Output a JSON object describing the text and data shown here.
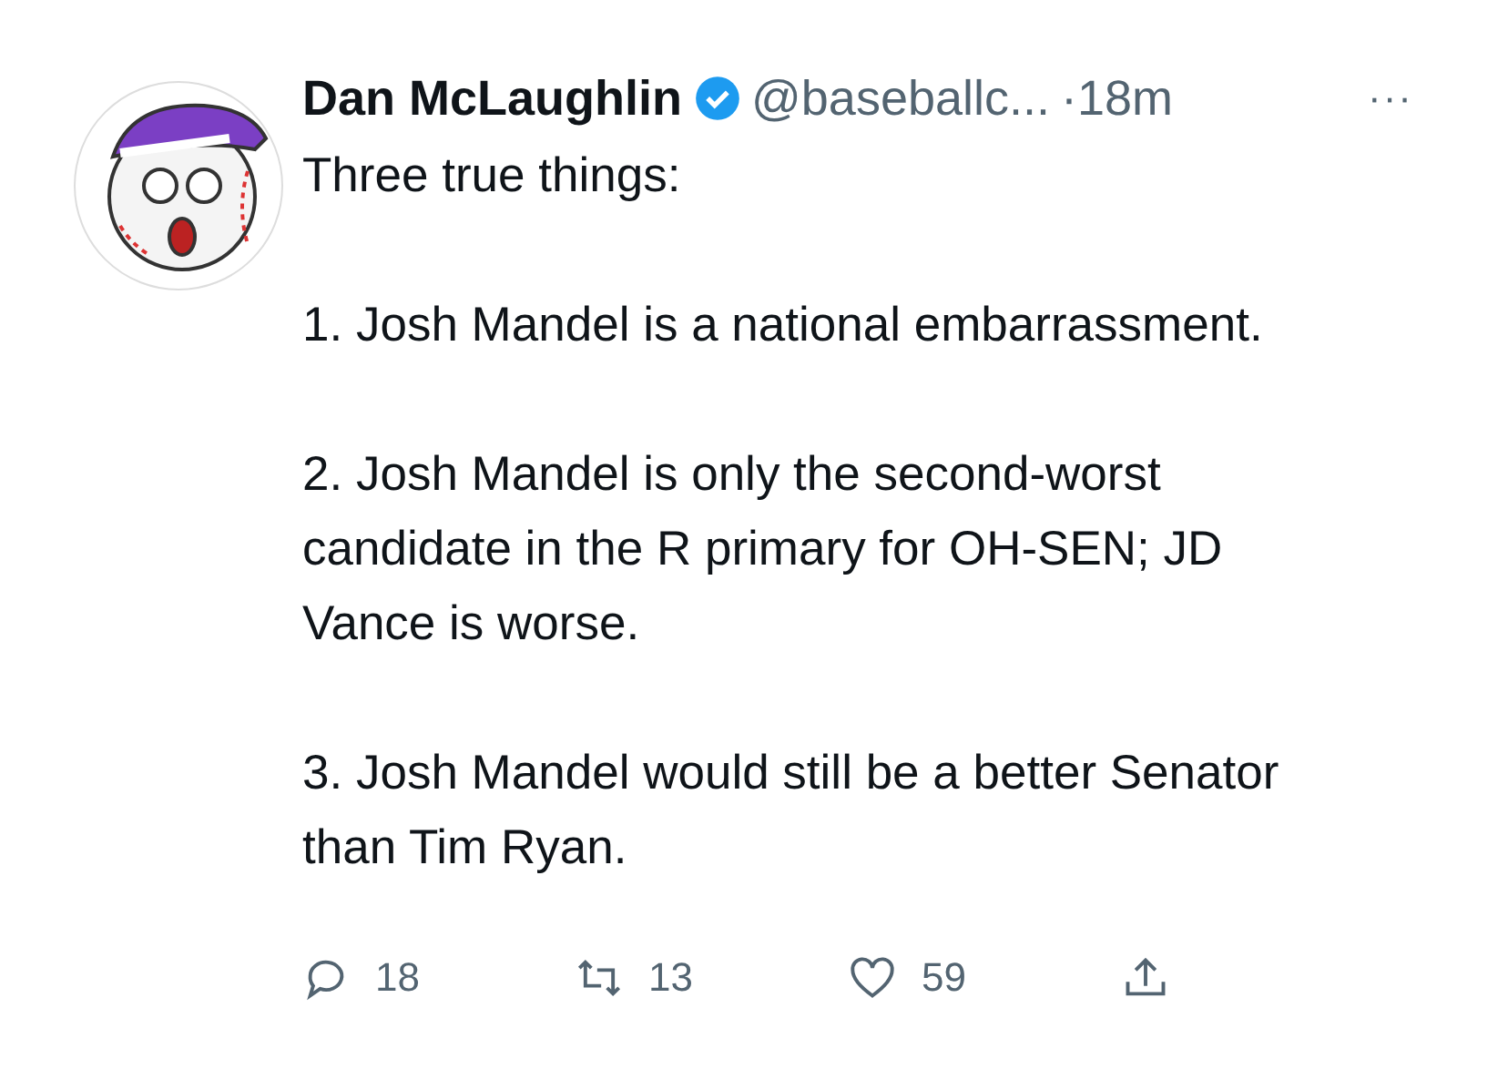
{
  "tweet": {
    "name": "Dan McLaughlin",
    "verified": true,
    "handle": "@baseballc...",
    "time": "·18m",
    "more": "···",
    "paragraphs": [
      "Three true things:",
      "1. Josh Mandel is a national embarrassment.",
      "2. Josh Mandel is only the second-worst candidate in the R primary for OH-SEN; JD Vance is worse.",
      "3. Josh Mandel would still be a better Senator than Tim Ryan."
    ],
    "actions": [
      {
        "kind": "reply",
        "count": "18"
      },
      {
        "kind": "retweet",
        "count": "13"
      },
      {
        "kind": "like",
        "count": "59"
      },
      {
        "kind": "share"
      }
    ]
  }
}
